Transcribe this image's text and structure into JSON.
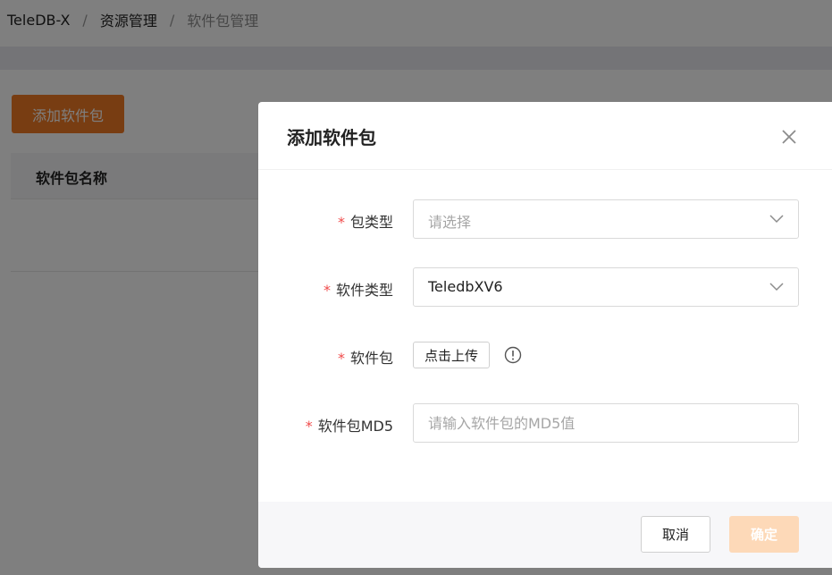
{
  "breadcrumb": [
    "TeleDB-X",
    "资源管理",
    "软件包管理"
  ],
  "breadcrumb_separator": "/",
  "page": {
    "add_button": "添加软件包",
    "table_header": "软件包名称",
    "accent_color": "#f07a24"
  },
  "dialog": {
    "title": "添加软件包",
    "close_icon": "close-icon",
    "required_mark": "*",
    "fields": {
      "package_type": {
        "label": "包类型",
        "placeholder": "请选择"
      },
      "software_type": {
        "label": "软件类型",
        "value": "TeledbXV6"
      },
      "package": {
        "label": "软件包",
        "upload_button": "点击上传",
        "icon": "info-circle-icon"
      },
      "md5": {
        "label": "软件包MD5",
        "placeholder": "请输入软件包的MD5值"
      }
    },
    "footer": {
      "cancel": "取消",
      "ok": "确定"
    }
  }
}
